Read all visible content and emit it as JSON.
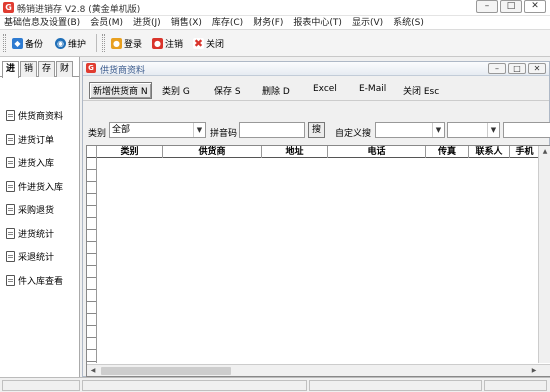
{
  "app": {
    "title": "畅销进销存 V2.8 (黄金单机版)",
    "icon_letter": "G"
  },
  "window_controls": {
    "minimize": "–",
    "maximize": "□",
    "close": "✕"
  },
  "menu": [
    "基础信息及设置(B)",
    "会员(M)",
    "进货(J)",
    "销售(X)",
    "库存(C)",
    "财务(F)",
    "报表中心(T)",
    "显示(V)",
    "系统(S)"
  ],
  "toolbar": {
    "backup": "备份",
    "maintain": "维护",
    "login": "登录",
    "logout": "注销",
    "close": "关闭"
  },
  "sidebar": {
    "tabs": [
      "进",
      "销",
      "存",
      "财"
    ],
    "items": [
      "供货商资料",
      "进货订单",
      "进货入库",
      "件进货入库",
      "采购退货",
      "进货统计",
      "采退统计",
      "件入库查看"
    ]
  },
  "child_window": {
    "title": "供货商资料",
    "toolbar": {
      "new": "新增供货商 N",
      "category": "类别 G",
      "save": "保存 S",
      "delete": "删除 D",
      "excel": "Excel",
      "email": "E-Mail",
      "close": "关闭 Esc"
    },
    "filter": {
      "category_label": "类别",
      "category_value": "全部",
      "pinyin_label": "拼音码",
      "search_button": "搜",
      "custom_label": "自定义搜"
    },
    "grid": {
      "columns": [
        "类别",
        "供货商",
        "地址",
        "电话",
        "传真",
        "联系人",
        "手机"
      ]
    }
  },
  "icons": {
    "scroll_up": "▲",
    "scroll_left": "◀",
    "scroll_right": "▶",
    "dropdown": "▼"
  }
}
